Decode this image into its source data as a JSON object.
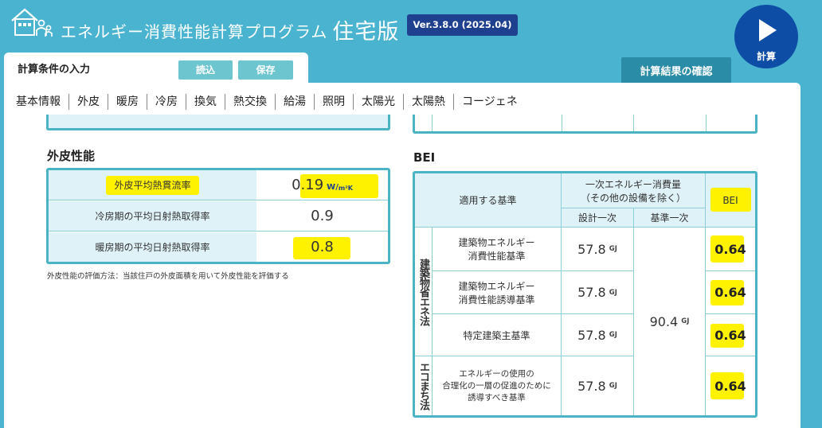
{
  "header": {
    "app_name": "エネルギー消費性能計算プログラム",
    "app_edition": "住宅版",
    "version": "Ver.3.8.0 (2025.04)",
    "calc_button": "計算",
    "logo_icon": "house-people-icon",
    "play_icon": "play-icon"
  },
  "panel": {
    "title": "計算条件の入力",
    "load_button": "読込",
    "save_button": "保存",
    "results_button": "計算結果の確認"
  },
  "tabs": [
    "基本情報",
    "外皮",
    "暖房",
    "冷房",
    "換気",
    "熱交換",
    "給湯",
    "照明",
    "太陽光",
    "太陽熱",
    "コージェネ"
  ],
  "envelope": {
    "title": "外皮性能",
    "rows": [
      {
        "label": "外皮平均熱貫流率",
        "value": "0.19",
        "unit_main": "W/",
        "unit_sub": "m²K"
      },
      {
        "label": "冷房期の平均日射熱取得率",
        "value": "0.9"
      },
      {
        "label": "暖房期の平均日射熱取得率",
        "value": "0.8"
      }
    ],
    "note": "外皮性能の評価方法：当該住戸の外皮面積を用いて外皮性能を評価する"
  },
  "bei": {
    "title": "BEI",
    "headers": {
      "standard": "適用する基準",
      "primary_energy_line1": "一次エネルギー消費量",
      "primary_energy_line2": "（その他の設備を除く）",
      "design": "設計一次",
      "reference": "基準一次",
      "bei": "BEI"
    },
    "groups": [
      "建築物省エネ法",
      "エコまち法"
    ],
    "rows": [
      {
        "standard_line1": "建築物エネルギー",
        "standard_line2": "消費性能基準",
        "standard_line3": "",
        "design": "57.8",
        "bei": "0.64"
      },
      {
        "standard_line1": "建築物エネルギー",
        "standard_line2": "消費性能誘導基準",
        "standard_line3": "",
        "design": "57.8",
        "bei": "0.64"
      },
      {
        "standard_line1": "特定建築主基準",
        "standard_line2": "",
        "standard_line3": "",
        "design": "57.8",
        "bei": "0.64"
      },
      {
        "standard_line1": "エネルギーの使用の",
        "standard_line2": "合理化の一層の促進のために",
        "standard_line3": "誘導すべき基準",
        "design": "57.8",
        "bei": "0.64"
      }
    ],
    "reference_value": "90.4",
    "unit": "GJ"
  },
  "colors": {
    "header_bg": "#4ab3cf",
    "table_border": "#4bb4c4",
    "label_bg": "#dff2f8",
    "highlight": "#fff200",
    "version_bg": "#1f3f8f",
    "calc_bg": "#0d4da6"
  }
}
